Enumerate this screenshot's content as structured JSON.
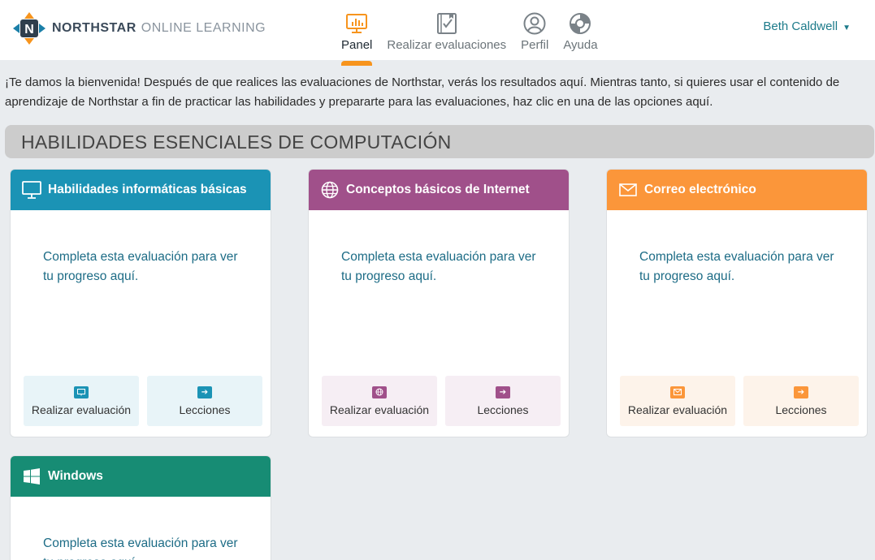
{
  "header": {
    "brand_bold": "NORTHSTAR",
    "brand_light": "ONLINE LEARNING",
    "logo_letter": "N",
    "nav": [
      {
        "label": "Panel",
        "icon": "dashboard-chart-icon",
        "active": true
      },
      {
        "label": "Realizar evaluaciones",
        "icon": "assessment-book-icon",
        "active": false
      },
      {
        "label": "Perfil",
        "icon": "user-profile-icon",
        "active": false
      },
      {
        "label": "Ayuda",
        "icon": "lifebuoy-icon",
        "active": false
      }
    ],
    "user_name": "Beth Caldwell",
    "user_caret": "▼"
  },
  "welcome_text": "¡Te damos la bienvenida! Después de que realices las evaluaciones de Northstar, verás los resultados aquí. Mientras tanto, si quieres usar el contenido de aprendizaje de Northstar a fin de practicar las habilidades y prepararte para las evaluaciones, haz clic en una de las opciones aquí.",
  "section_title": "HABILIDADES ESENCIALES DE COMPUTACIÓN",
  "cards": [
    {
      "title": "Habilidades informáticas básicas",
      "icon": "monitor-icon",
      "message": "Completa esta evaluación para ver tu progreso aquí.",
      "assess_label": "Realizar evaluación",
      "lessons_label": "Lecciones",
      "color": "#1b93b5"
    },
    {
      "title": "Conceptos básicos de Internet",
      "icon": "globe-icon",
      "message": "Completa esta evaluación para ver tu progreso aquí.",
      "assess_label": "Realizar evaluación",
      "lessons_label": "Lecciones",
      "color": "#a0508a"
    },
    {
      "title": "Correo electrónico",
      "icon": "envelope-icon",
      "message": "Completa esta evaluación para ver tu progreso aquí.",
      "assess_label": "Realizar evaluación",
      "lessons_label": "Lecciones",
      "color": "#fb963a"
    },
    {
      "title": "Windows",
      "icon": "windows-logo-icon",
      "message": "Completa esta evaluación para ver tu progreso aquí.",
      "color": "#178c74"
    }
  ],
  "colors": {
    "accent": "#f7941d",
    "link": "#1d7b8a"
  }
}
